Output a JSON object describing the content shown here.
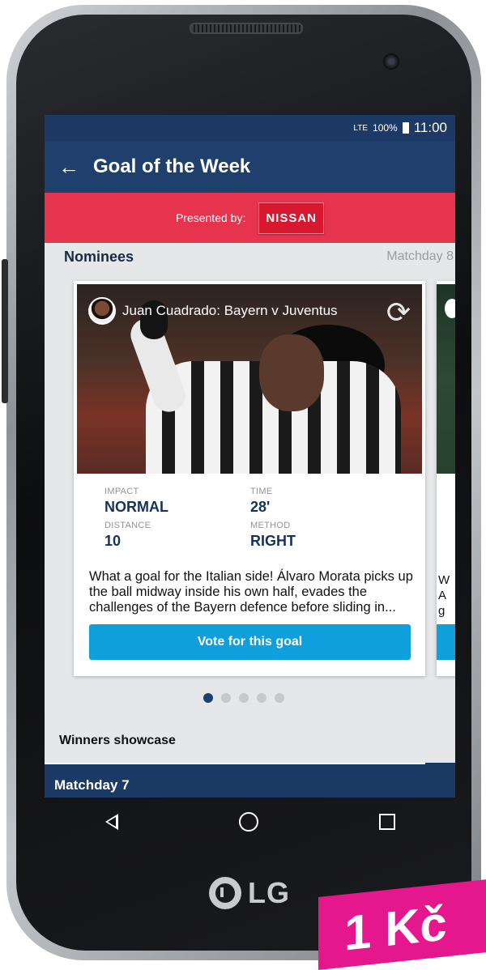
{
  "status_bar": {
    "network": "LTE",
    "battery": "100%",
    "time": "11:00"
  },
  "app_bar": {
    "title": "Goal of the Week"
  },
  "sponsor": {
    "label": "Presented by:",
    "brand": "NISSAN"
  },
  "nominees": {
    "heading": "Nominees",
    "matchday": "Matchday 8",
    "cards": [
      {
        "caption": "Juan Cuadrado: Bayern v Juventus",
        "impact_label": "IMPACT",
        "impact_value": "NORMAL",
        "time_label": "TIME",
        "time_value": "28'",
        "distance_label": "DISTANCE",
        "distance_value": "10",
        "method_label": "METHOD",
        "method_value": "RIGHT",
        "description": "What a goal for the Italian side! Álvaro Morata picks up the ball midway inside his own half, evades the challenges of the Bayern defence before sliding in...",
        "vote_label": "Vote for this goal"
      }
    ],
    "peek_text": "W\nA\ng",
    "pagination": {
      "total": 5,
      "active": 1
    }
  },
  "winners": {
    "heading": "Winners showcase",
    "matchday": "Matchday 7"
  },
  "device": {
    "brand": "LG"
  },
  "price_tag": "1 Kč",
  "colors": {
    "primary": "#1f3f6d",
    "sponsor_bg": "#e6334e",
    "vote_button": "#0f9fdd",
    "price_bg": "#e5178d"
  },
  "icons": [
    "back-arrow-icon",
    "refresh-icon",
    "nav-back-icon",
    "nav-home-icon",
    "nav-recent-icon",
    "lte-signal-icon",
    "battery-icon"
  ]
}
